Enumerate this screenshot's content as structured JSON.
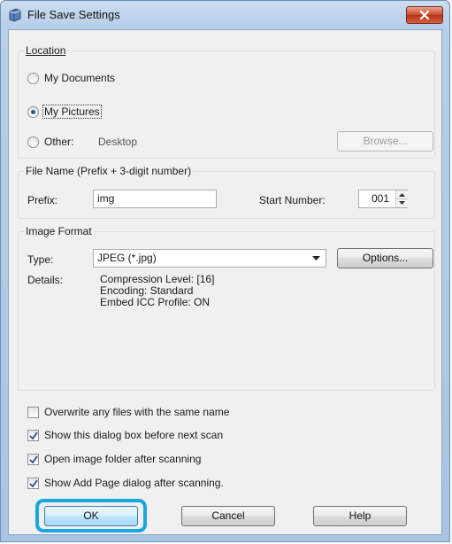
{
  "window": {
    "title": "File Save Settings"
  },
  "location": {
    "group_title": "Location",
    "options": [
      "My Documents",
      "My Pictures",
      "Other:"
    ],
    "other_path": "Desktop",
    "browse_label": "Browse..."
  },
  "file_name": {
    "group_title": "File Name (Prefix + 3-digit number)",
    "prefix_label": "Prefix:",
    "prefix_value": "img",
    "start_number_label": "Start Number:",
    "start_number_value": "001"
  },
  "image_format": {
    "group_title": "Image Format",
    "type_label": "Type:",
    "type_value": "JPEG (*.jpg)",
    "options_label": "Options...",
    "details_label": "Details:",
    "details_lines": [
      "Compression Level: [16]",
      "Encoding: Standard",
      "Embed ICC Profile: ON"
    ]
  },
  "checkboxes": [
    {
      "label": "Overwrite any files with the same name",
      "checked": false
    },
    {
      "label": "Show this dialog box before next scan",
      "checked": true
    },
    {
      "label": "Open image folder after scanning",
      "checked": true
    },
    {
      "label": "Show Add Page dialog after scanning.",
      "checked": true
    }
  ],
  "buttons": {
    "ok": "OK",
    "cancel": "Cancel",
    "help": "Help"
  }
}
